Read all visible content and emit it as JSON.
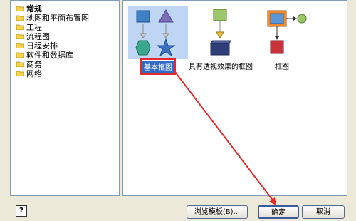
{
  "categories": [
    {
      "label": "常规",
      "selected": true
    },
    {
      "label": "地图和平面布置图"
    },
    {
      "label": "工程"
    },
    {
      "label": "流程图"
    },
    {
      "label": "日程安排"
    },
    {
      "label": "软件和数据库"
    },
    {
      "label": "商务"
    },
    {
      "label": "网络"
    }
  ],
  "templates": [
    {
      "label": "基本框图",
      "selected": true,
      "icon": "basic-shapes-icon"
    },
    {
      "label": "具有透视效果的框图",
      "icon": "perspective-block-icon"
    },
    {
      "label": "框图",
      "icon": "block-diagram-icon"
    }
  ],
  "buttons": {
    "help": "?",
    "browse": "浏览模板(B)...",
    "ok": "确定",
    "cancel": "取消"
  },
  "colors": {
    "selection": "#3169c6",
    "annotation": "#e32b2b",
    "folder": "#f5d64a"
  }
}
